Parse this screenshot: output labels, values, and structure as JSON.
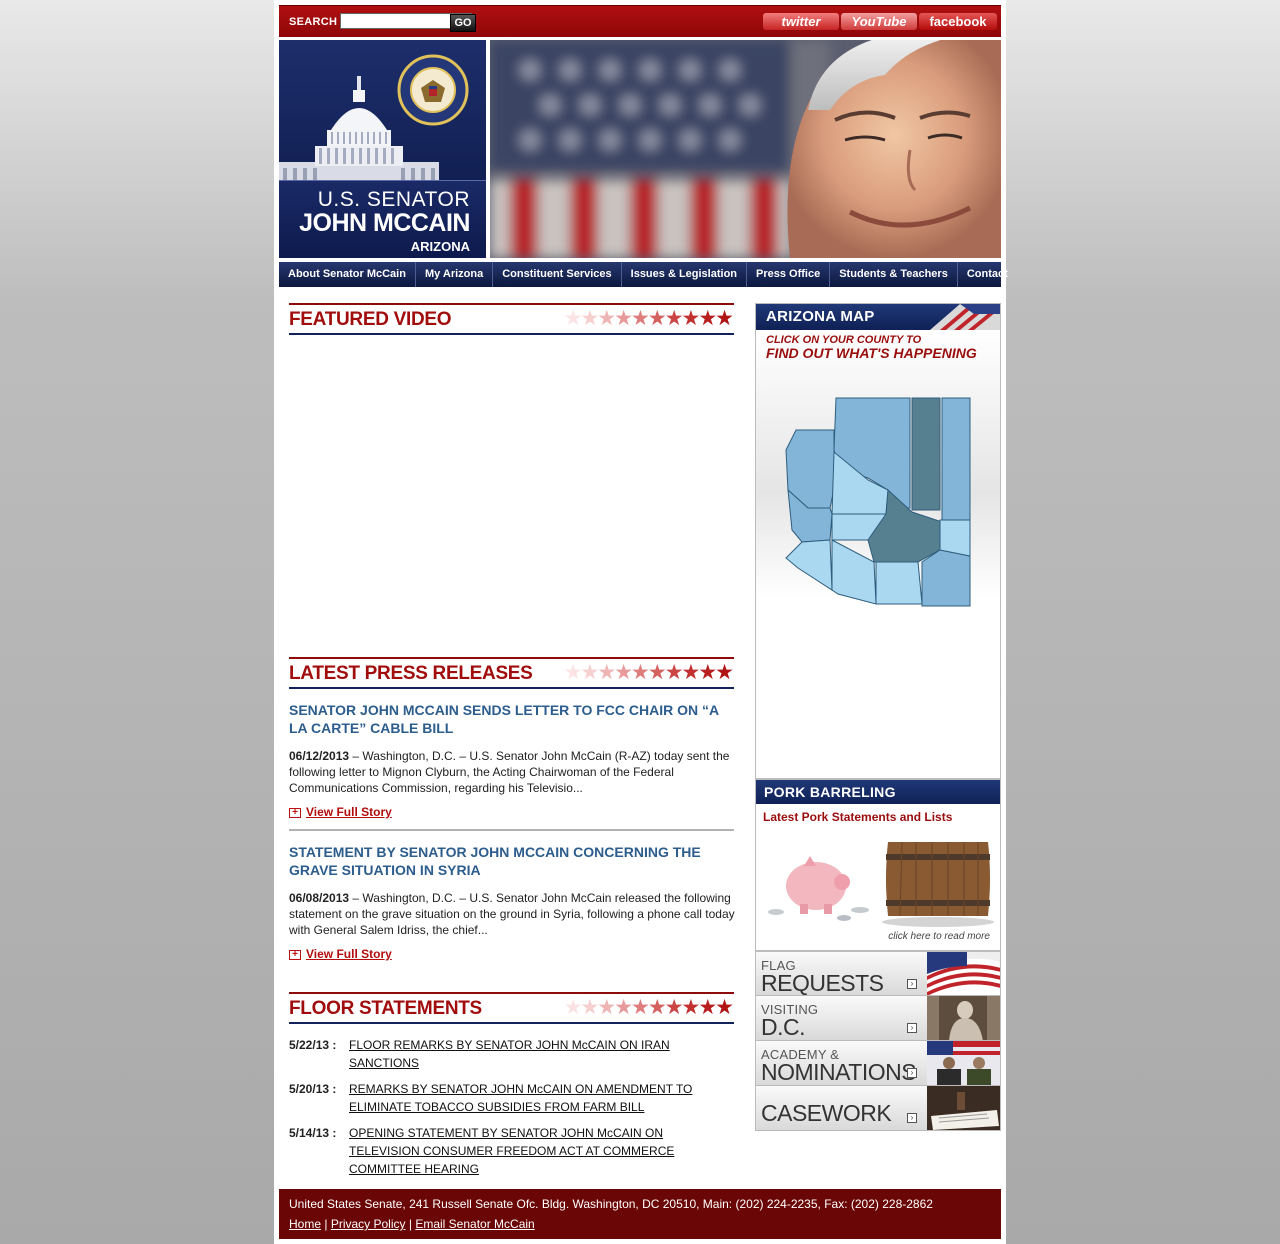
{
  "search": {
    "label": "SEARCH",
    "placeholder": "",
    "value": "",
    "go_label": "GO"
  },
  "social": {
    "twitter": "twitter",
    "youtube": "YouTube",
    "facebook": "facebook"
  },
  "header": {
    "title_line1": "U.S. SENATOR",
    "title_line2": "JOHN MCCAIN",
    "title_line3": "ARIZONA"
  },
  "nav": {
    "items": [
      "About Senator McCain",
      "My Arizona",
      "Constituent Services",
      "Issues & Legislation",
      "Press Office",
      "Students & Teachers",
      "Contact"
    ]
  },
  "featured_video": {
    "title": "FEATURED VIDEO"
  },
  "press_releases": {
    "title": "LATEST PRESS RELEASES",
    "items": [
      {
        "headline": "SENATOR JOHN MCCAIN SENDS LETTER TO FCC CHAIR ON “A LA CARTE” CABLE BILL",
        "date": "06/12/2013",
        "summary": " – Washington, D.C. – U.S. Senator John McCain (R-AZ) today sent the following letter to Mignon Clyburn, the Acting Chairwoman of the Federal Communications Commission, regarding his Televisio...",
        "more_label": "View Full Story"
      },
      {
        "headline": "STATEMENT BY SENATOR JOHN MCCAIN CONCERNING THE GRAVE SITUATION IN SYRIA",
        "date": "06/08/2013",
        "summary": " – Washington, D.C. – U.S. Senator John McCain released the following statement on the grave situation on the ground in Syria, following a phone call today with General Salem Idriss, the chief...",
        "more_label": "View Full Story"
      }
    ]
  },
  "floor_statements": {
    "title": "FLOOR STATEMENTS",
    "items": [
      {
        "date": "5/22/13 :",
        "text": "FLOOR REMARKS BY SENATOR JOHN McCAIN ON IRAN SANCTIONS"
      },
      {
        "date": "5/20/13 :",
        "text": "REMARKS BY SENATOR JOHN McCAIN ON AMENDMENT TO ELIMINATE TOBACCO SUBSIDIES FROM FARM BILL"
      },
      {
        "date": "5/14/13 :",
        "text": "OPENING STATEMENT BY SENATOR JOHN McCAIN ON TELEVISION CONSUMER FREEDOM ACT AT COMMERCE COMMITTEE HEARING"
      }
    ]
  },
  "sidebar": {
    "map": {
      "title": "ARIZONA MAP",
      "sub_line1": "CLICK ON YOUR COUNTY TO",
      "sub_line2": "FIND OUT WHAT'S HAPPENING"
    },
    "pork": {
      "title": "PORK BARRELING",
      "subtitle": "Latest Pork Statements and Lists",
      "more": "click here to read more"
    },
    "links": [
      {
        "small": "FLAG",
        "big": "REQUESTS"
      },
      {
        "small": "VISITING",
        "big": "D.C."
      },
      {
        "small": "ACADEMY &",
        "big": "NOMINATIONS"
      },
      {
        "small": "",
        "big": "CASEWORK"
      }
    ]
  },
  "footer": {
    "address": "United States Senate, 241 Russell Senate Ofc. Bldg. Washington, DC 20510, Main: (202) 224-2235, Fax: (202) 228-2862",
    "links": [
      "Home",
      "Privacy Policy",
      "Email Senator McCain"
    ],
    "separator": "|"
  },
  "colors": {
    "brand_red": "#a10d0d",
    "navy": "#13225a",
    "link_blue": "#2c5d8d",
    "footer_bg": "#6b0606"
  }
}
